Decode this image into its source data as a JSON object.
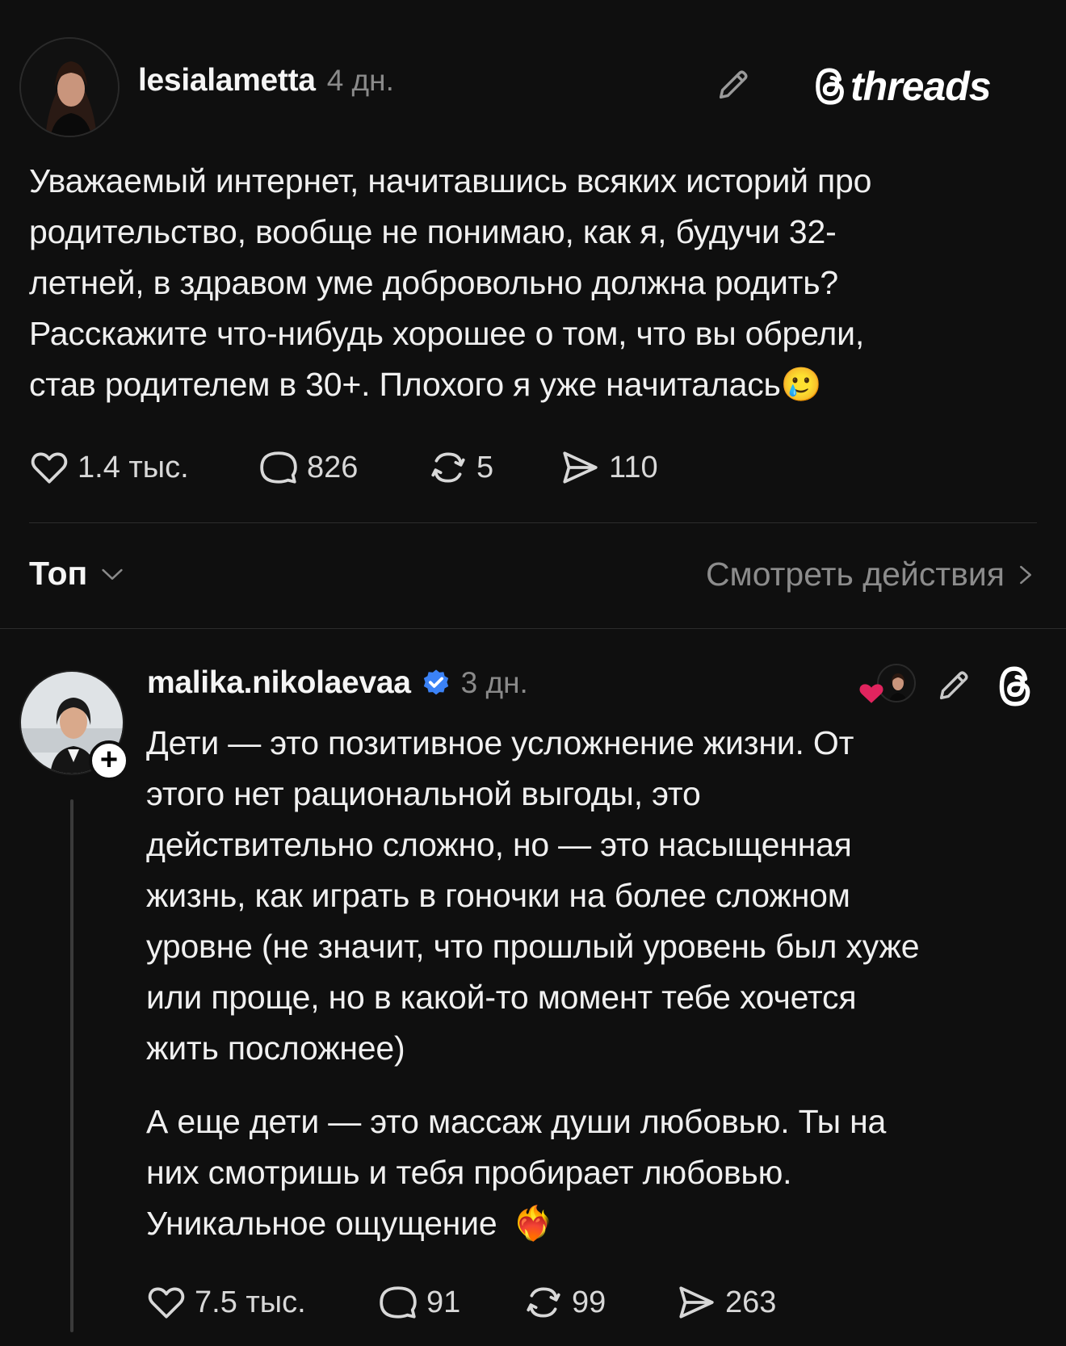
{
  "post": {
    "username": "lesialametta",
    "time": "4 дн.",
    "brand": "threads",
    "text_lines": [
      "Уважаемый интернет, начитавшись всяких историй про",
      "родительство, вообще не понимаю, как я, будучи 32-",
      "летней, в здравом уме добровольно должна родить?",
      "Расскажите что-нибудь хорошее  о том, что вы обрели,",
      "став родителем в 30+. Плохого я уже начиталась"
    ],
    "emoji_end": "🥲",
    "stats": {
      "likes": "1.4 тыс.",
      "comments": "826",
      "reposts": "5",
      "shares": "110"
    }
  },
  "sort": {
    "label": "Топ",
    "activity_label": "Смотреть действия"
  },
  "reply": {
    "username": "malika.nikolaevaa",
    "time": "3 дн.",
    "follow_symbol": "+",
    "text_lines_1": [
      "Дети — это позитивное усложнение жизни. От",
      "этого нет рациональной выгоды, это",
      "действительно сложно, но — это насыщенная",
      "жизнь, как играть в гоночки на более сложном",
      "уровне (не значит, что прошлый уровень был хуже",
      "или проще, но в какой-то момент тебе хочется",
      "жить посложнее)"
    ],
    "text_lines_2": [
      "А еще дети — это массаж души любовью. Ты на",
      "них смотришь и тебя пробирает любовью.",
      "Уникальное ощущение"
    ],
    "emoji_end": "❤️‍🔥",
    "stats": {
      "likes": "7.5 тыс.",
      "comments": "91",
      "reposts": "99",
      "shares": "263"
    }
  },
  "colors": {
    "background": "#0f0f0f",
    "verified": "#3b82f6",
    "heart": "#e0245e"
  },
  "icons": [
    "pencil-icon",
    "threads-logo-icon",
    "heart-icon",
    "comment-icon",
    "repost-icon",
    "share-icon",
    "chevron-down-icon",
    "chevron-right-icon",
    "verified-badge-icon",
    "plus-icon"
  ]
}
